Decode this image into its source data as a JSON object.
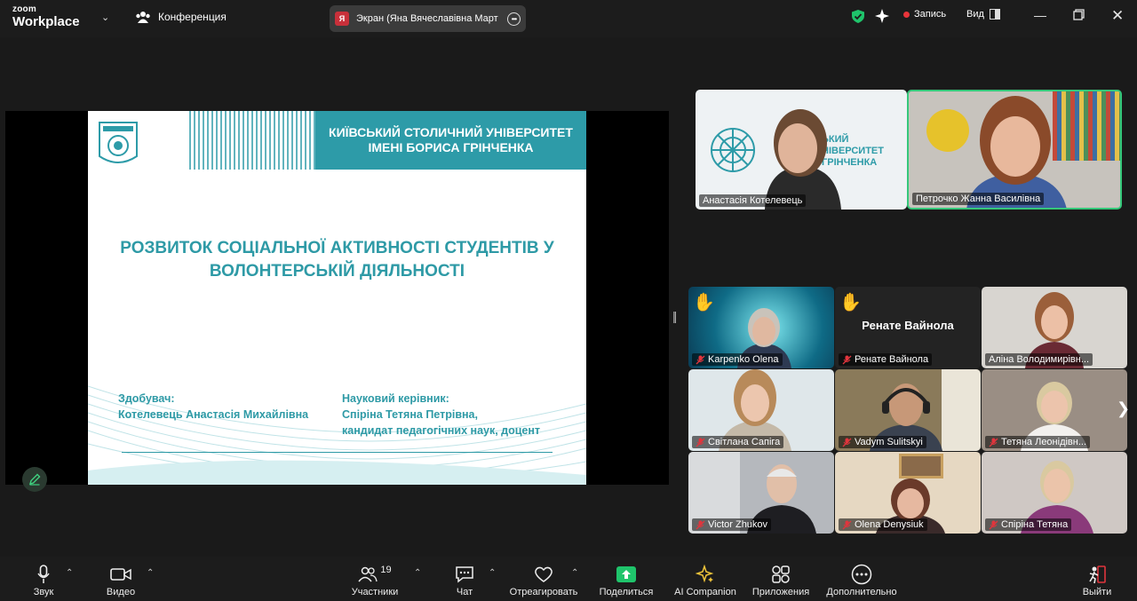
{
  "topbar": {
    "logo_line1": "zoom",
    "logo_line2": "Workplace",
    "conference_label": "Конференция",
    "share_avatar_letter": "Я",
    "share_label": "Экран (Яна Вячеславівна Март",
    "record_label": "Запись",
    "view_label": "Вид"
  },
  "slide": {
    "university_line1": "КИЇВСЬКИЙ СТОЛИЧНИЙ УНІВЕРСИТЕТ",
    "university_line2": "ІМЕНІ БОРИСА ГРІНЧЕНКА",
    "title_line1": "РОЗВИТОК СОЦІАЛЬНОЇ АКТИВНОСТІ СТУДЕНТІВ У",
    "title_line2": "ВОЛОНТЕРСЬКІЙ ДІЯЛЬНОСТІ",
    "applicant_label": "Здобувач:",
    "applicant_name": "Котелевець Анастасія Михайлівна",
    "supervisor_label": "Науковий керівник:",
    "supervisor_name": "Спіріна Тетяна Петрівна,",
    "supervisor_title": "кандидат педагогічних наук, доцент",
    "accent_color": "#2d9ba8"
  },
  "featured_tiles": [
    {
      "name": "Анастасія Котелевець",
      "overlay_line1": "ЬКИЙ",
      "overlay_line2": "НІВЕРСИТЕТ",
      "overlay_line3": "ГРІНЧЕНКА"
    },
    {
      "name": "Петрочко Жанна Василівна",
      "active_speaker": true
    }
  ],
  "gallery_tiles": [
    {
      "name": "Karpenko Olena",
      "muted": true,
      "hand_raised": true
    },
    {
      "name": "Ренате  Вайнола",
      "muted": true,
      "hand_raised": true,
      "display_text": "Ренате  Вайнола"
    },
    {
      "name": "Аліна Володимирівн...",
      "muted": false,
      "hand_raised": false
    },
    {
      "name": "Світлана Сапіга",
      "muted": true,
      "hand_raised": false
    },
    {
      "name": "Vadym Sulitskyi",
      "muted": true,
      "hand_raised": false
    },
    {
      "name": "Тетяна Леонідівн...",
      "muted": true,
      "hand_raised": false
    },
    {
      "name": "Victor Zhukov",
      "muted": true,
      "hand_raised": false
    },
    {
      "name": "Olena Denysiuk",
      "muted": true,
      "hand_raised": false
    },
    {
      "name": "Спіріна Тетяна",
      "muted": true,
      "hand_raised": false
    }
  ],
  "toolbar": {
    "mic": "Звук",
    "video": "Видео",
    "participants": "Участники",
    "participants_count": "19",
    "chat": "Чат",
    "react": "Отреагировать",
    "share": "Поделиться",
    "ai": "AI Companion",
    "apps": "Приложения",
    "more": "Дополнительно",
    "leave": "Выйти"
  },
  "colors": {
    "share_green": "#1fc46b",
    "mute_red": "#e0353d",
    "active_border": "#35c87a",
    "ai_yellow": "#f0c43a"
  }
}
